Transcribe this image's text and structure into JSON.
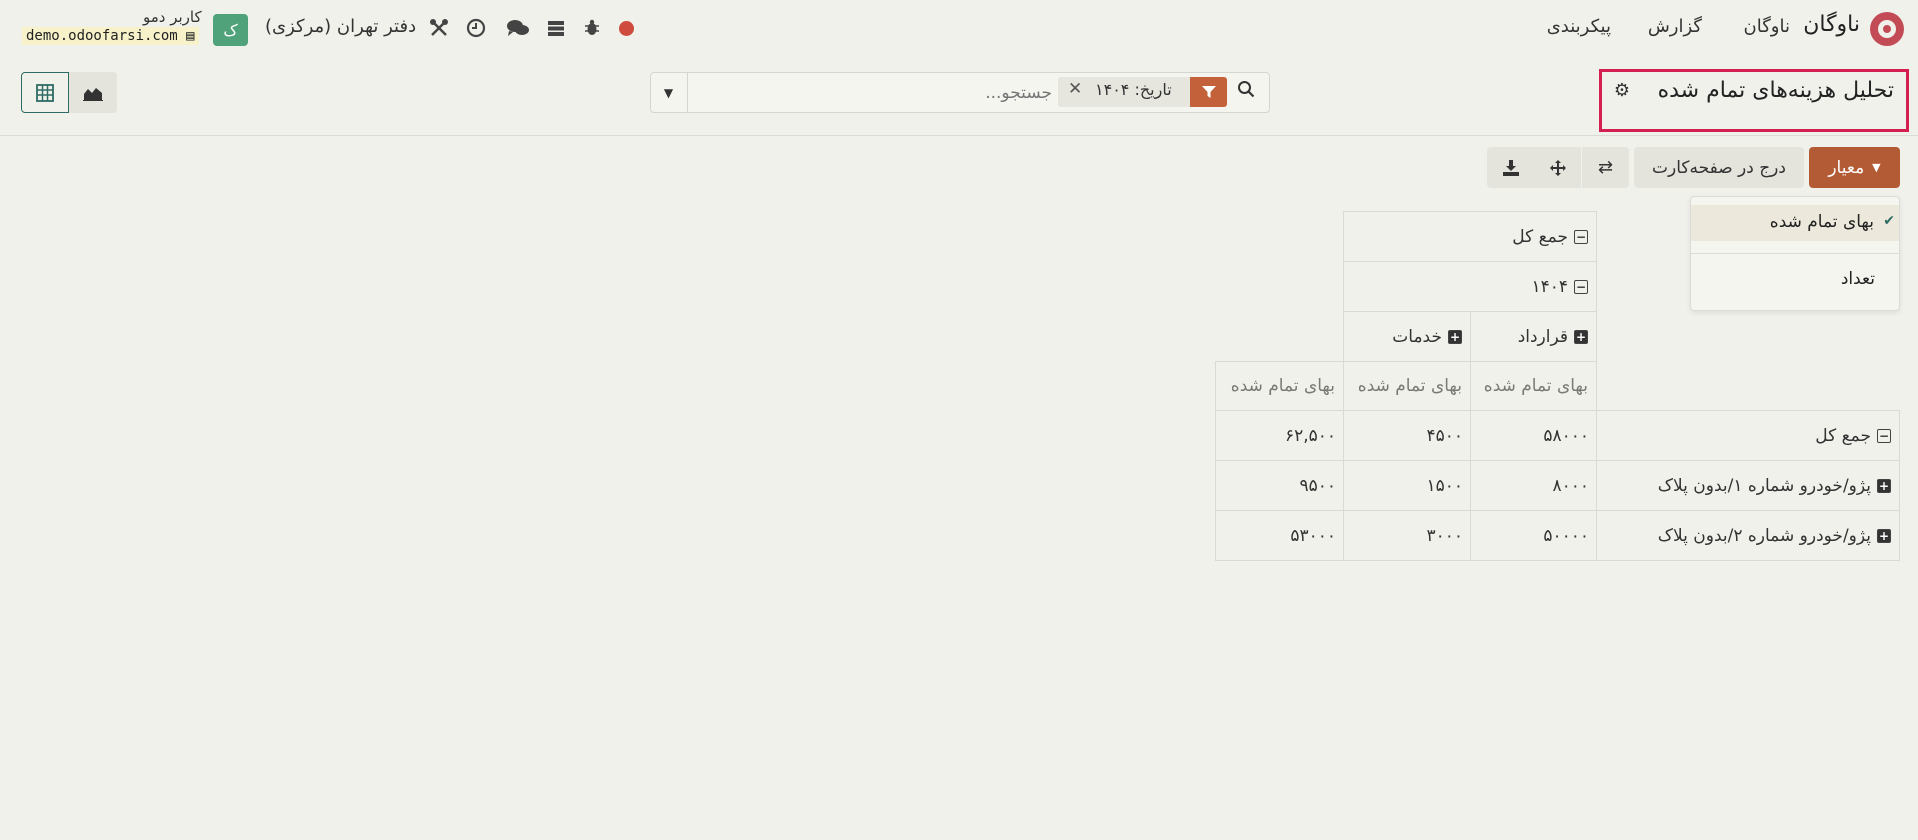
{
  "navbar": {
    "brand": "ناوگان",
    "menu": [
      "ناوگان",
      "گزارش",
      "پیکربندی"
    ],
    "company": "دفتر تهران (مرکزی)",
    "avatar_letter": "ک",
    "username": "کاربر دمو",
    "database": "demo.odoofarsi.com",
    "icons": [
      "record-icon",
      "bug-icon",
      "database-icon",
      "chat-icon",
      "clock-icon",
      "tools-icon"
    ]
  },
  "control_panel": {
    "title": "تحلیل هزینه‌های تمام شده",
    "search_placeholder": "جستجو...",
    "facet_label": "تاریخ: ۱۴۰۴",
    "views": [
      "pivot-view",
      "graph-view"
    ]
  },
  "toolbar": {
    "measures_label": "معیار",
    "insert_label": "درج در صفحه‌کارت"
  },
  "measures_menu": {
    "items": [
      {
        "label": "بهای تمام شده",
        "checked": true
      },
      {
        "label": "تعداد",
        "checked": false
      }
    ]
  },
  "pivot": {
    "col_total": "جمع کل",
    "col_year": "۱۴۰۴",
    "col_groups": [
      "قرارداد",
      "خدمات"
    ],
    "measure": "بهای تمام شده",
    "rows": [
      {
        "label": "جمع کل",
        "values": [
          "۵۸۰۰۰",
          "۴۵۰۰",
          "۶۲,۵۰۰"
        ]
      },
      {
        "label": "پژو/خودرو شماره ۱/بدون پلاک",
        "values": [
          "۸۰۰۰",
          "۱۵۰۰",
          "۹۵۰۰"
        ]
      },
      {
        "label": "پژو/خودرو شماره ۲/بدون پلاک",
        "values": [
          "۵۰۰۰۰",
          "۳۰۰۰",
          "۵۳۰۰۰"
        ]
      }
    ]
  }
}
